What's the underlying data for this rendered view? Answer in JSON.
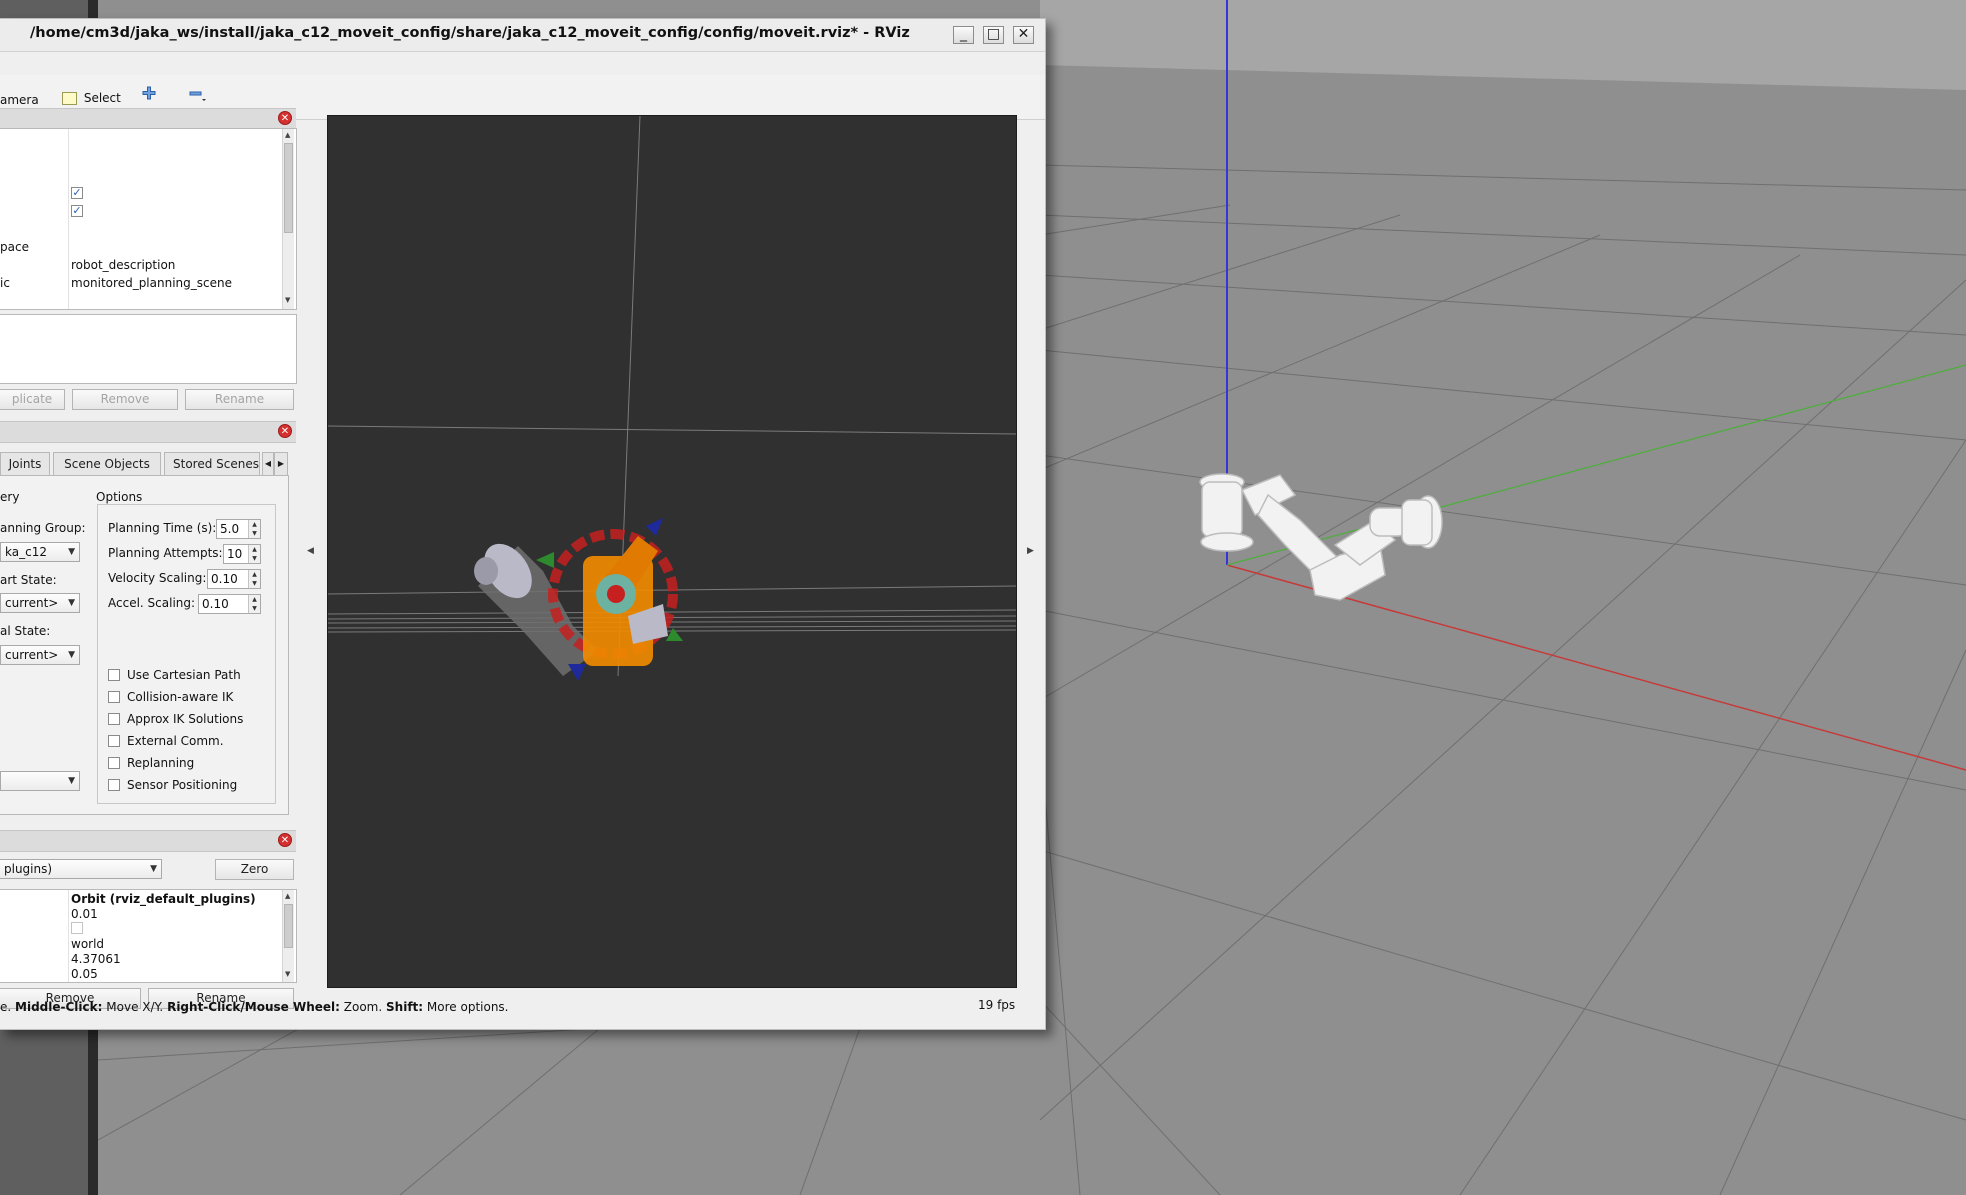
{
  "window": {
    "title": "/home/cm3d/jaka_ws/install/jaka_c12_moveit_config/share/jaka_c12_moveit_config/config/moveit.rviz* - RViz",
    "minimize_label": "_",
    "maximize_label": "□",
    "close_label": "✕"
  },
  "toolbar": {
    "camera_label": "amera",
    "select_label": "Select"
  },
  "displays_panel": {
    "properties": [
      {
        "label": "",
        "value": "",
        "checked": true
      },
      {
        "label": "",
        "value": "",
        "checked": true
      },
      {
        "label": "pace",
        "value": "robot_description"
      },
      {
        "label": "ic",
        "value": "monitored_planning_scene"
      }
    ],
    "buttons": {
      "duplicate": "plicate",
      "remove": "Remove",
      "rename": "Rename"
    }
  },
  "motion_panel": {
    "tabs": [
      "Joints",
      "Scene Objects",
      "Stored Scenes"
    ],
    "query": {
      "section_label": "ery",
      "planning_group_label": "anning Group:",
      "planning_group_value": "ka_c12",
      "start_state_label": "art State:",
      "start_state_value": "current>",
      "goal_state_label": "al State:",
      "goal_state_value": "current>"
    },
    "options": {
      "title": "Options",
      "planning_time_label": "Planning Time (s):",
      "planning_time_value": "5.0",
      "planning_attempts_label": "Planning Attempts:",
      "planning_attempts_value": "10",
      "velocity_scaling_label": "Velocity Scaling:",
      "velocity_scaling_value": "0.10",
      "accel_scaling_label": "Accel. Scaling:",
      "accel_scaling_value": "0.10",
      "checkboxes": [
        "Use Cartesian Path",
        "Collision-aware IK",
        "Approx IK Solutions",
        "External Comm.",
        "Replanning",
        "Sensor Positioning"
      ]
    }
  },
  "views_panel": {
    "view_type": "plugins)",
    "zero_label": "Zero",
    "values": [
      "Orbit (rviz_default_plugins)",
      "0.01",
      "",
      "world",
      "4.37061",
      "0.05"
    ],
    "remove_label": "Remove",
    "rename_label": "Rename"
  },
  "status": {
    "hint_prefix": "e.",
    "middle_click_label": "Middle-Click:",
    "middle_click_text": "Move X/Y.",
    "right_click_label": "Right-Click/Mouse Wheel:",
    "right_click_text": "Zoom.",
    "shift_label": "Shift:",
    "shift_text": "More options.",
    "fps": "19 fps"
  },
  "colors": {
    "viewport_bg": "#303030",
    "scene_floor": "#8f8f8f",
    "axis_x": "#c63a3a",
    "axis_y": "#4caf3a",
    "axis_z": "#3636d8",
    "robot_highlight": "#f08a00",
    "close_button": "#d53030"
  }
}
